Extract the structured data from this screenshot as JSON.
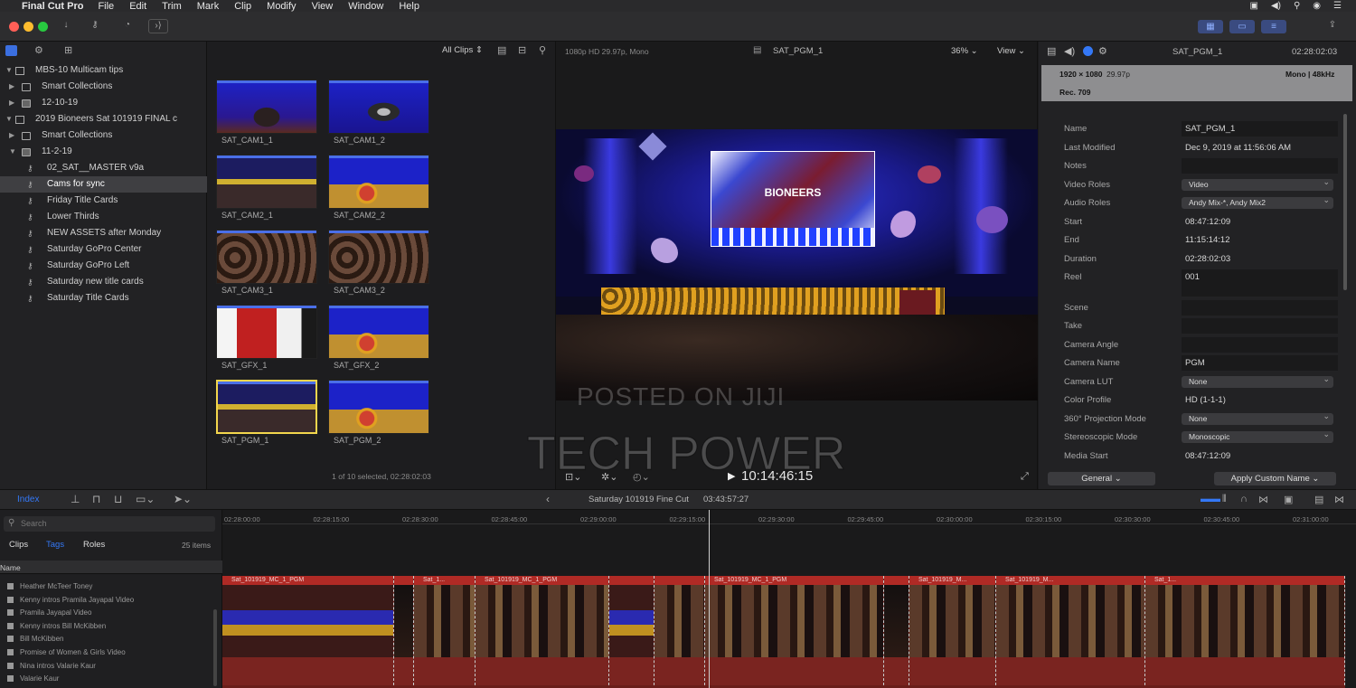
{
  "menubar": {
    "app_name": "Final Cut Pro",
    "items": [
      "File",
      "Edit",
      "Trim",
      "Mark",
      "Clip",
      "Modify",
      "View",
      "Window",
      "Help"
    ]
  },
  "library": {
    "rows": [
      {
        "label": "MBS-10 Multicam tips",
        "level": 0,
        "kind": "library",
        "expanded": true,
        "selected": false
      },
      {
        "label": "Smart Collections",
        "level": 1,
        "kind": "folder",
        "expanded": false,
        "selected": false
      },
      {
        "label": "12-10-19",
        "level": 1,
        "kind": "event",
        "expanded": false,
        "selected": false
      },
      {
        "label": "2019 Bioneers Sat 101919 FINAL c",
        "level": 0,
        "kind": "library",
        "expanded": true,
        "selected": false
      },
      {
        "label": "Smart Collections",
        "level": 1,
        "kind": "folder",
        "expanded": false,
        "selected": false
      },
      {
        "label": "11-2-19",
        "level": 1,
        "kind": "event",
        "expanded": true,
        "selected": false
      },
      {
        "label": "02_SAT__MASTER v9a",
        "level": 2,
        "kind": "keyword",
        "selected": false
      },
      {
        "label": "Cams for sync",
        "level": 2,
        "kind": "keyword",
        "selected": true
      },
      {
        "label": "Friday Title Cards",
        "level": 2,
        "kind": "keyword",
        "selected": false
      },
      {
        "label": "Lower Thirds",
        "level": 2,
        "kind": "keyword",
        "selected": false
      },
      {
        "label": "NEW ASSETS after Monday",
        "level": 2,
        "kind": "keyword",
        "selected": false
      },
      {
        "label": "Saturday GoPro Center",
        "level": 2,
        "kind": "keyword",
        "selected": false
      },
      {
        "label": "Saturday GoPro Left",
        "level": 2,
        "kind": "keyword",
        "selected": false
      },
      {
        "label": "Saturday new title cards",
        "level": 2,
        "kind": "keyword",
        "selected": false
      },
      {
        "label": "Saturday Title Cards",
        "level": 2,
        "kind": "keyword",
        "selected": false
      }
    ]
  },
  "browser": {
    "filter_label": "All Clips",
    "status": "1 of 10 selected, 02:28:02:03",
    "clips": [
      {
        "name": "SAT_CAM1_1",
        "style": "speaker-a",
        "selected": false
      },
      {
        "name": "SAT_CAM1_2",
        "style": "speaker-b",
        "selected": false
      },
      {
        "name": "SAT_CAM2_1",
        "style": "wide",
        "selected": false
      },
      {
        "name": "SAT_CAM2_2",
        "style": "podium",
        "selected": false
      },
      {
        "name": "SAT_CAM3_1",
        "style": "crowd",
        "selected": false
      },
      {
        "name": "SAT_CAM3_2",
        "style": "crowd",
        "selected": false
      },
      {
        "name": "SAT_GFX_1",
        "style": "gfx",
        "selected": false
      },
      {
        "name": "SAT_GFX_2",
        "style": "podium",
        "selected": false
      },
      {
        "name": "SAT_PGM_1",
        "style": "wide",
        "selected": true
      },
      {
        "name": "SAT_PGM_2",
        "style": "podium",
        "selected": false
      }
    ]
  },
  "viewer": {
    "format": "1080p HD 29.97p, Mono",
    "clip_name": "SAT_PGM_1",
    "zoom": "36%",
    "view_label": "View",
    "screen_text": "BIONEERS",
    "timecode": "10:14:46:15"
  },
  "watermark": {
    "line1": "POSTED ON JIJI",
    "line2": "TECH POWER"
  },
  "inspector": {
    "clip_name": "SAT_PGM_1",
    "duration": "02:28:02:03",
    "resolution": "1920 × 1080",
    "fps": "29.97p",
    "audio": "Mono | 48kHz",
    "codec": "Rec. 709",
    "rows": [
      {
        "label": "Name",
        "value": "SAT_PGM_1",
        "type": "field"
      },
      {
        "label": "Last Modified",
        "value": "Dec 9, 2019 at 11:56:06 AM",
        "type": "plain"
      },
      {
        "label": "Notes",
        "value": "",
        "type": "field"
      },
      {
        "label": "Video Roles",
        "value": "Video",
        "type": "popup"
      },
      {
        "label": "Audio Roles",
        "value": "Andy Mix-*, Andy Mix2",
        "type": "popup"
      },
      {
        "label": "Start",
        "value": "08:47:12:09",
        "type": "plain"
      },
      {
        "label": "End",
        "value": "11:15:14:12",
        "type": "plain"
      },
      {
        "label": "Duration",
        "value": "02:28:02:03",
        "type": "plain"
      },
      {
        "label": "Reel",
        "value": "001",
        "type": "tall"
      },
      {
        "label": "Scene",
        "value": "",
        "type": "field"
      },
      {
        "label": "Take",
        "value": "",
        "type": "field"
      },
      {
        "label": "Camera Angle",
        "value": "",
        "type": "field"
      },
      {
        "label": "Camera Name",
        "value": "PGM",
        "type": "field"
      },
      {
        "label": "Camera LUT",
        "value": "None",
        "type": "popup"
      },
      {
        "label": "Color Profile",
        "value": "HD (1-1-1)",
        "type": "plain"
      },
      {
        "label": "360° Projection Mode",
        "value": "None",
        "type": "popup"
      },
      {
        "label": "Stereoscopic Mode",
        "value": "Monoscopic",
        "type": "popup"
      },
      {
        "label": "Media Start",
        "value": "08:47:12:09",
        "type": "plain"
      }
    ],
    "footer_left": "General",
    "footer_right": "Apply Custom Name"
  },
  "timeline_bar": {
    "index_label": "Index",
    "project_name": "Saturday 101919 Fine Cut",
    "project_duration": "03:43:57:27"
  },
  "timeline_index": {
    "search_placeholder": "Search",
    "tabs": [
      "Clips",
      "Tags",
      "Roles"
    ],
    "active_tab": 1,
    "count": "25 items",
    "column_header": "Name",
    "items": [
      "Heather McTeer Toney",
      "Kenny intros Pramila Jayapal Video",
      "Pramila Jayapal Video",
      "Kenny intros Bill McKibben",
      "Bill McKibben",
      "Promise of Women & Girls Video",
      "Nina intros Valarie Kaur",
      "Valarie Kaur"
    ]
  },
  "timeline": {
    "ruler": [
      "02:28:00:00",
      "02:28:15:00",
      "02:28:30:00",
      "02:28:45:00",
      "02:29:00:00",
      "02:29:15:00",
      "02:29:30:00",
      "02:29:45:00",
      "02:30:00:00",
      "02:30:15:00",
      "02:30:30:00",
      "02:30:45:00",
      "02:31:00:00"
    ],
    "clips": [
      {
        "label": "Sat_101919_MC_1_PGM",
        "tone": "stage"
      },
      {
        "label": "",
        "tone": "dark"
      },
      {
        "label": "Sat_1...",
        "tone": "crowd"
      },
      {
        "label": "Sat_101919_MC_1_PGM",
        "tone": "crowd"
      },
      {
        "label": "",
        "tone": "stage"
      },
      {
        "label": "",
        "tone": "crowd"
      },
      {
        "label": "Sat_101919_MC_1_PGM",
        "tone": "crowd"
      },
      {
        "label": "",
        "tone": "dark"
      },
      {
        "label": "Sat_101919_M...",
        "tone": "crowd"
      },
      {
        "label": "Sat_101919_M...",
        "tone": "crowd"
      },
      {
        "label": "Sat_1...",
        "tone": "crowd"
      }
    ]
  },
  "colors": {
    "accent": "#3478f6",
    "selection": "#f2d64d",
    "clip_red": "#b02a25",
    "stage_blue": "#2a2fb0"
  }
}
